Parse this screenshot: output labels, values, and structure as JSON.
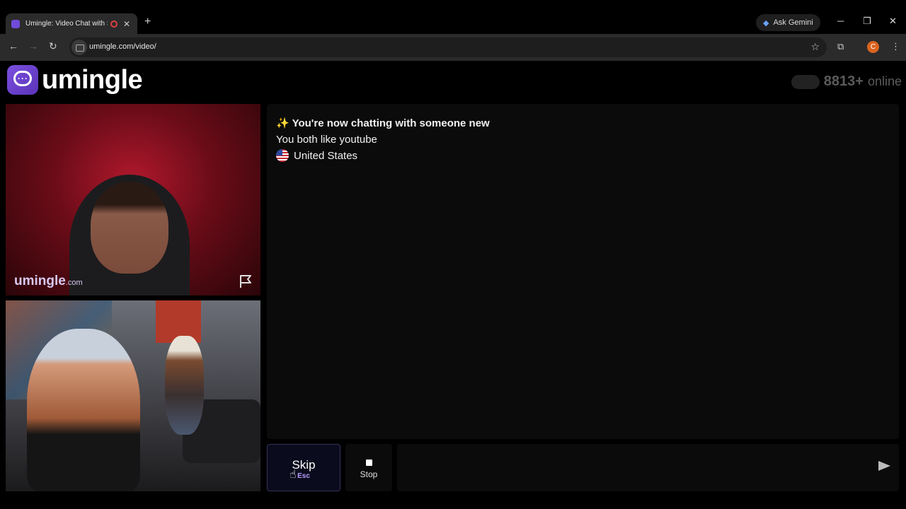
{
  "browser": {
    "tab_title": "Umingle: Video Chat with Strangers",
    "new_tab": "+",
    "tab_close": "✕",
    "ask_gemini": "Ask Gemini",
    "url": "umingle.com/video/",
    "profile_initial": "C",
    "minimize": "─",
    "restore": "❐",
    "close": "✕"
  },
  "app": {
    "logo": "umingle",
    "online_count": "8813+",
    "online_label": "online",
    "watermark_main": "umingle",
    "watermark_suffix": ".com"
  },
  "chat": {
    "headline": "✨ You're now chatting with someone new",
    "shared_interest": "You both like youtube",
    "country": "United States"
  },
  "controls": {
    "skip_label": "Skip",
    "skip_key": "Esc",
    "stop_label": "Stop",
    "message_placeholder": ""
  },
  "colors": {
    "brand": "#6f4bd8",
    "skip_key": "#b9a0ff"
  }
}
